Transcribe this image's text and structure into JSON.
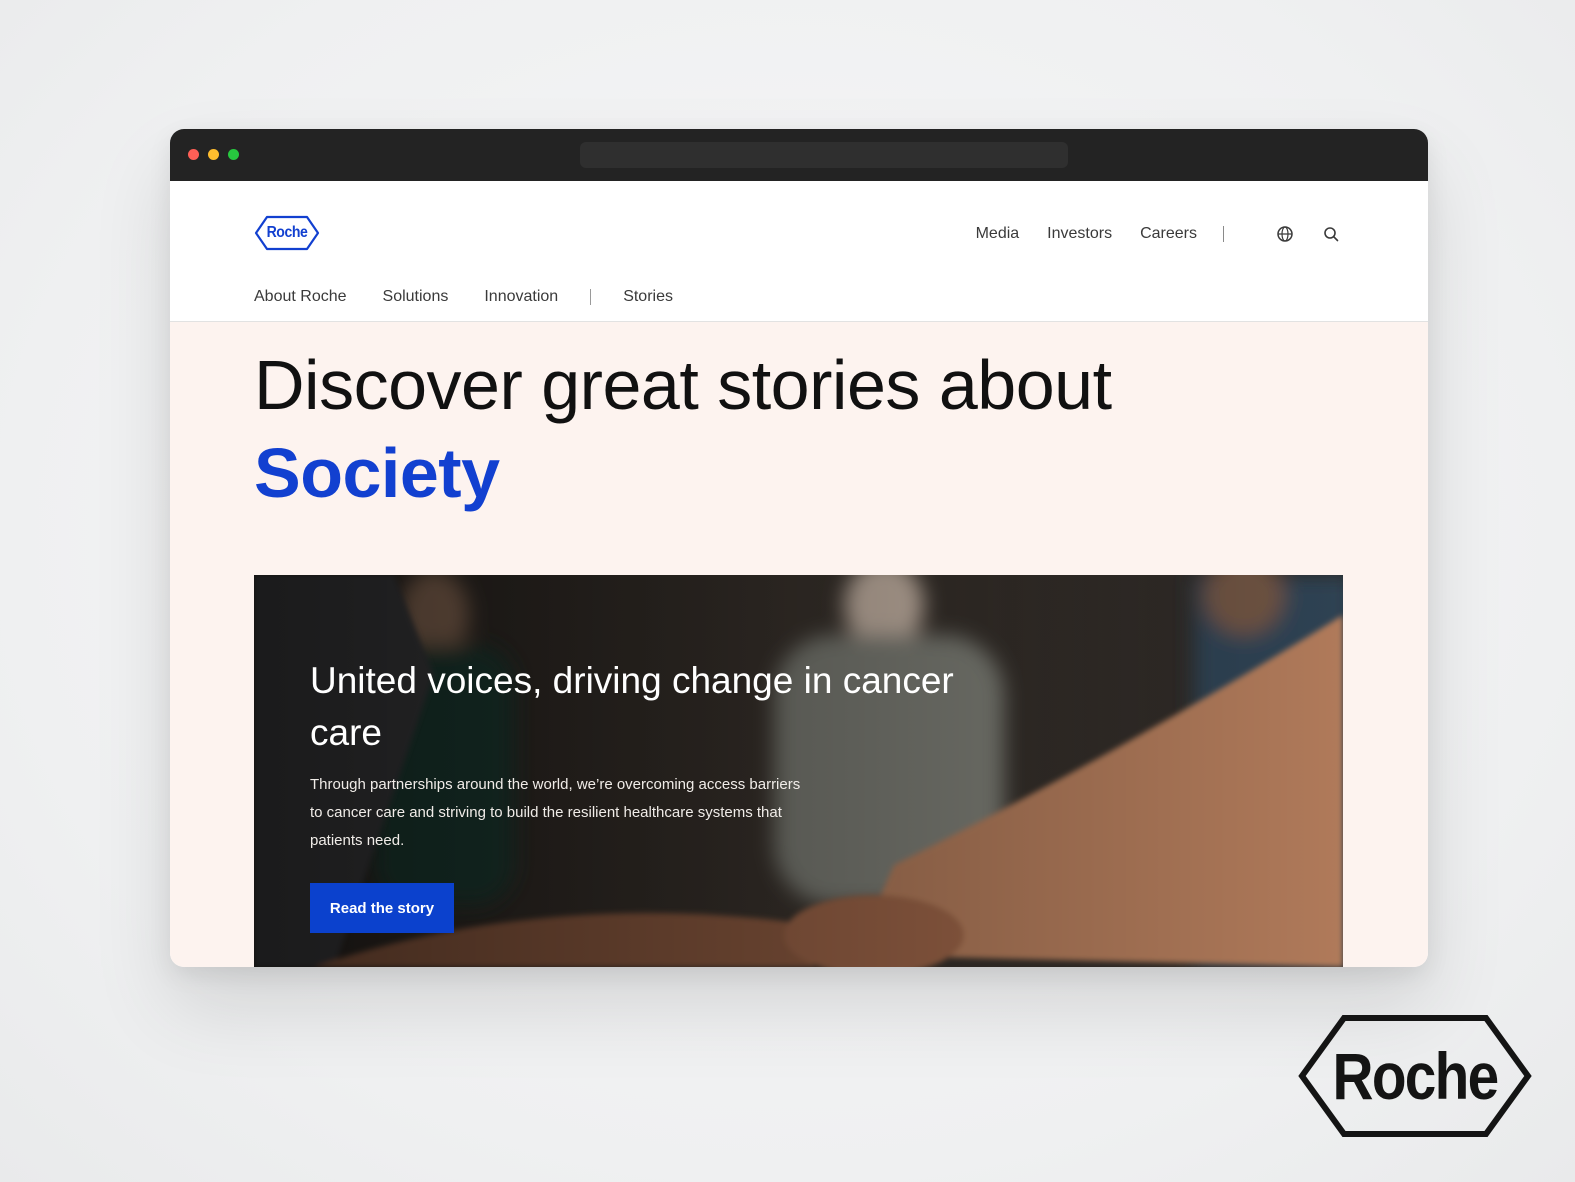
{
  "brand": {
    "name": "Roche",
    "accent_color": "#0b41cd",
    "logo_color": "#1240d0"
  },
  "header": {
    "top_nav": [
      "Media",
      "Investors",
      "Careers"
    ],
    "icons": [
      "globe-icon",
      "search-icon"
    ],
    "main_nav": [
      "About Roche",
      "Solutions",
      "Innovation",
      "Stories"
    ]
  },
  "hero": {
    "title": "Discover great stories about",
    "accent": "Society"
  },
  "feature": {
    "title": "United voices, driving change in cancer care",
    "text": "Through partnerships around the world, we’re overcoming access barriers to cancer care and striving to build the resilient healthcare systems that patients need.",
    "cta_label": "Read the story"
  },
  "corner_logo": {
    "text": "Roche"
  }
}
